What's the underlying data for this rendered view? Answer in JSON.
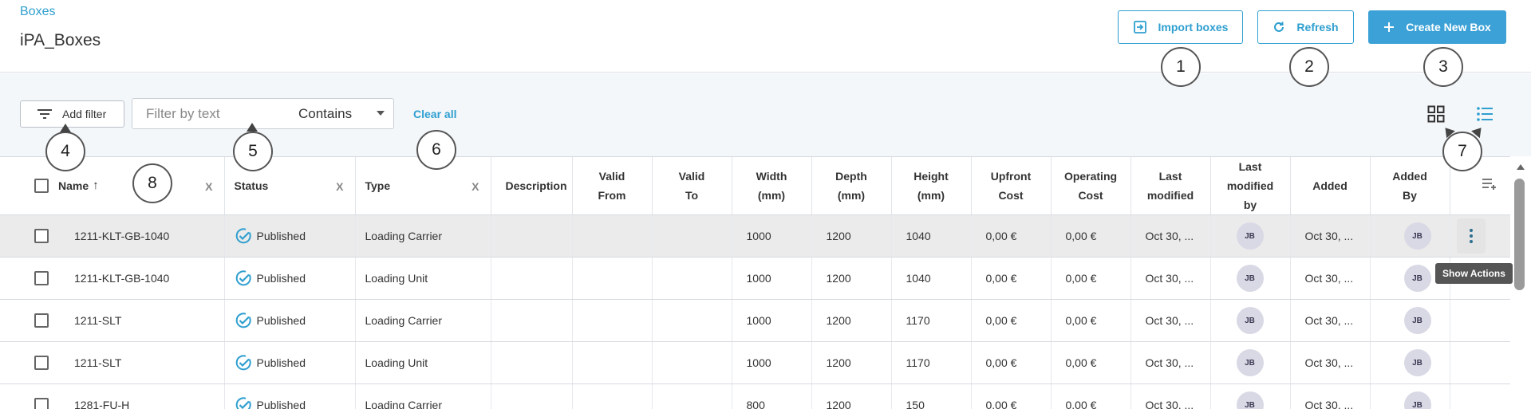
{
  "header": {
    "breadcrumb": "Boxes",
    "title": "iPA_Boxes",
    "import_label": "Import boxes",
    "refresh_label": "Refresh",
    "create_label": "Create New Box"
  },
  "toolbar": {
    "add_filter_label": "Add filter",
    "filter_placeholder": "Filter by text",
    "filter_mode": "Contains",
    "clear_all_label": "Clear all"
  },
  "callouts": [
    "1",
    "2",
    "3",
    "4",
    "5",
    "6",
    "7",
    "8"
  ],
  "table": {
    "columns": {
      "name": "Name",
      "status": "Status",
      "type": "Type",
      "description": "Description",
      "valid_from_1": "Valid",
      "valid_from_2": "From",
      "valid_to_1": "Valid",
      "valid_to_2": "To",
      "width_1": "Width",
      "width_2": "(mm)",
      "depth_1": "Depth",
      "depth_2": "(mm)",
      "height_1": "Height",
      "height_2": "(mm)",
      "upfront_1": "Upfront",
      "upfront_2": "Cost",
      "operating_1": "Operating",
      "operating_2": "Cost",
      "last_modified_1": "Last",
      "last_modified_2": "modified",
      "last_modified_by_1": "Last",
      "last_modified_by_2": "modified",
      "last_modified_by_3": "by",
      "added": "Added",
      "added_by_1": "Added",
      "added_by_2": "By",
      "remove_x": "X"
    },
    "rows": [
      {
        "name": "1211-KLT-GB-1040",
        "status": "Published",
        "type": "Loading Carrier",
        "width": "1000",
        "depth": "1200",
        "height": "1040",
        "upfront": "0,00 €",
        "operating": "0,00 €",
        "last_modified": "Oct 30, ...",
        "modified_by": "JB",
        "added": "Oct 30, ...",
        "added_by": "JB"
      },
      {
        "name": "1211-KLT-GB-1040",
        "status": "Published",
        "type": "Loading Unit",
        "width": "1000",
        "depth": "1200",
        "height": "1040",
        "upfront": "0,00 €",
        "operating": "0,00 €",
        "last_modified": "Oct 30, ...",
        "modified_by": "JB",
        "added": "Oct 30, ...",
        "added_by": "JB"
      },
      {
        "name": "1211-SLT",
        "status": "Published",
        "type": "Loading Carrier",
        "width": "1000",
        "depth": "1200",
        "height": "1170",
        "upfront": "0,00 €",
        "operating": "0,00 €",
        "last_modified": "Oct 30, ...",
        "modified_by": "JB",
        "added": "Oct 30, ...",
        "added_by": "JB"
      },
      {
        "name": "1211-SLT",
        "status": "Published",
        "type": "Loading Unit",
        "width": "1000",
        "depth": "1200",
        "height": "1170",
        "upfront": "0,00 €",
        "operating": "0,00 €",
        "last_modified": "Oct 30, ...",
        "modified_by": "JB",
        "added": "Oct 30, ...",
        "added_by": "JB"
      },
      {
        "name": "1281-FU-H",
        "status": "Published",
        "type": "Loading Carrier",
        "width": "800",
        "depth": "1200",
        "height": "150",
        "upfront": "0,00 €",
        "operating": "0,00 €",
        "last_modified": "Oct 30, ...",
        "modified_by": "JB",
        "added": "Oct 30, ...",
        "added_by": "JB"
      }
    ],
    "tooltip": "Show Actions"
  },
  "colors": {
    "accent": "#2f9fd0",
    "primary_button": "#3ba1d6",
    "toolbar_bg": "#f4f7fa",
    "selected_row": "#ebebeb"
  }
}
